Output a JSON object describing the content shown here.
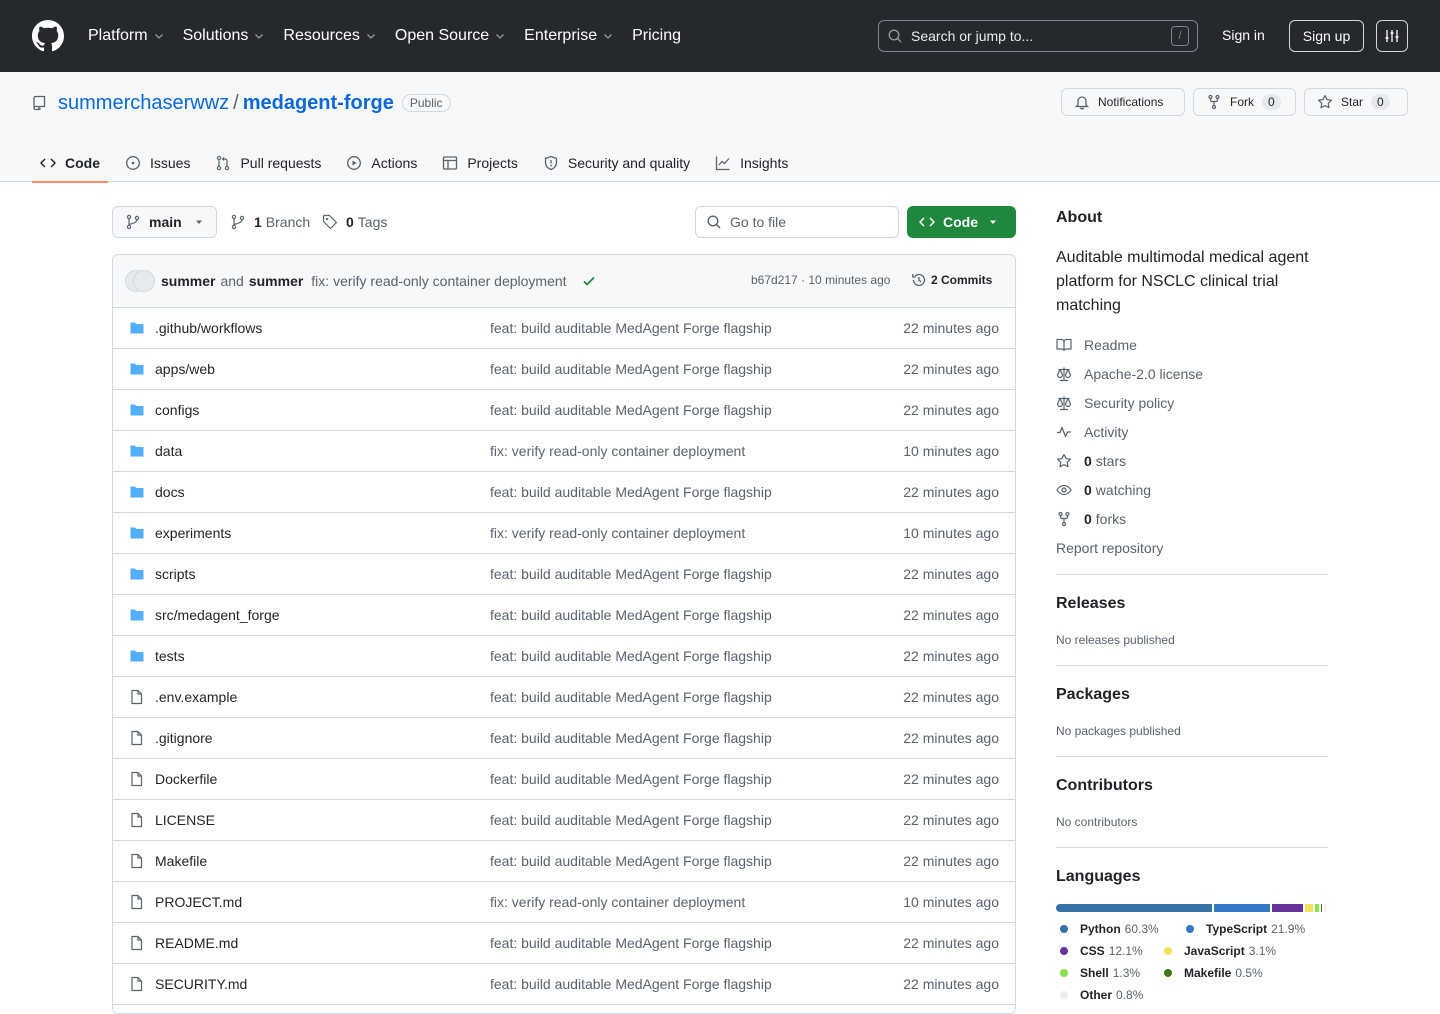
{
  "header": {
    "nav": [
      "Platform",
      "Solutions",
      "Resources",
      "Open Source",
      "Enterprise",
      "Pricing"
    ],
    "search_placeholder": "Search or jump to...",
    "search_key": "/",
    "sign_in": "Sign in",
    "sign_up": "Sign up"
  },
  "repo": {
    "owner": "summerchaserwwz",
    "separator": "/",
    "name": "medagent-forge",
    "visibility": "Public",
    "notifications": "Notifications",
    "fork_label": "Fork",
    "fork_count": "0",
    "star_label": "Star",
    "star_count": "0"
  },
  "tabs": [
    "Code",
    "Issues",
    "Pull requests",
    "Actions",
    "Projects",
    "Security and quality",
    "Insights"
  ],
  "browser": {
    "branch": "main",
    "branch_count": "1",
    "branch_label": "Branch",
    "tag_count": "0",
    "tag_label": "Tags",
    "goto_placeholder": "Go to file",
    "code_button": "Code"
  },
  "commit": {
    "author1": "summer",
    "and": "and",
    "author2": "summer",
    "message": "fix: verify read-only container deployment",
    "sha_time": "b67d217 · 10 minutes ago",
    "commits": "2 Commits"
  },
  "files": [
    {
      "type": "dir",
      "name": ".github/workflows",
      "message": "feat: build auditable MedAgent Forge flagship",
      "time": "22 minutes ago"
    },
    {
      "type": "dir",
      "name": "apps/web",
      "message": "feat: build auditable MedAgent Forge flagship",
      "time": "22 minutes ago"
    },
    {
      "type": "dir",
      "name": "configs",
      "message": "feat: build auditable MedAgent Forge flagship",
      "time": "22 minutes ago"
    },
    {
      "type": "dir",
      "name": "data",
      "message": "fix: verify read-only container deployment",
      "time": "10 minutes ago"
    },
    {
      "type": "dir",
      "name": "docs",
      "message": "feat: build auditable MedAgent Forge flagship",
      "time": "22 minutes ago"
    },
    {
      "type": "dir",
      "name": "experiments",
      "message": "fix: verify read-only container deployment",
      "time": "10 minutes ago"
    },
    {
      "type": "dir",
      "name": "scripts",
      "message": "feat: build auditable MedAgent Forge flagship",
      "time": "22 minutes ago"
    },
    {
      "type": "dir",
      "name": "src/medagent_forge",
      "message": "feat: build auditable MedAgent Forge flagship",
      "time": "22 minutes ago"
    },
    {
      "type": "dir",
      "name": "tests",
      "message": "feat: build auditable MedAgent Forge flagship",
      "time": "22 minutes ago"
    },
    {
      "type": "file",
      "name": ".env.example",
      "message": "feat: build auditable MedAgent Forge flagship",
      "time": "22 minutes ago"
    },
    {
      "type": "file",
      "name": ".gitignore",
      "message": "feat: build auditable MedAgent Forge flagship",
      "time": "22 minutes ago"
    },
    {
      "type": "file",
      "name": "Dockerfile",
      "message": "feat: build auditable MedAgent Forge flagship",
      "time": "22 minutes ago"
    },
    {
      "type": "file",
      "name": "LICENSE",
      "message": "feat: build auditable MedAgent Forge flagship",
      "time": "22 minutes ago"
    },
    {
      "type": "file",
      "name": "Makefile",
      "message": "feat: build auditable MedAgent Forge flagship",
      "time": "22 minutes ago"
    },
    {
      "type": "file",
      "name": "PROJECT.md",
      "message": "fix: verify read-only container deployment",
      "time": "10 minutes ago"
    },
    {
      "type": "file",
      "name": "README.md",
      "message": "feat: build auditable MedAgent Forge flagship",
      "time": "22 minutes ago"
    },
    {
      "type": "file",
      "name": "SECURITY.md",
      "message": "feat: build auditable MedAgent Forge flagship",
      "time": "22 minutes ago"
    }
  ],
  "about": {
    "title": "About",
    "description": "Auditable multimodal medical agent platform for NSCLC clinical trial matching",
    "links": [
      {
        "icon": "book-icon",
        "label": "Readme",
        "count": ""
      },
      {
        "icon": "scale-icon",
        "label": "Apache-2.0 license",
        "count": ""
      },
      {
        "icon": "scale-icon",
        "label": "Security policy",
        "count": ""
      },
      {
        "icon": "pulse-icon",
        "label": "Activity",
        "count": ""
      },
      {
        "icon": "star-icon",
        "label": "stars",
        "count": "0"
      },
      {
        "icon": "eye-icon",
        "label": "watching",
        "count": "0"
      },
      {
        "icon": "fork-icon",
        "label": "forks",
        "count": "0"
      }
    ],
    "report": "Report repository"
  },
  "releases": {
    "title": "Releases",
    "text": "No releases published"
  },
  "packages": {
    "title": "Packages",
    "text": "No packages published"
  },
  "contributors": {
    "title": "Contributors",
    "text": "No contributors"
  },
  "languages": {
    "title": "Languages",
    "items": [
      {
        "name": "Python",
        "percent": "60.3%",
        "value": 60.3,
        "color": "#3572A5"
      },
      {
        "name": "TypeScript",
        "percent": "21.9%",
        "value": 21.9,
        "color": "#3178c6"
      },
      {
        "name": "CSS",
        "percent": "12.1%",
        "value": 12.1,
        "color": "#663399"
      },
      {
        "name": "JavaScript",
        "percent": "3.1%",
        "value": 3.1,
        "color": "#f1e05a"
      },
      {
        "name": "Shell",
        "percent": "1.3%",
        "value": 1.3,
        "color": "#89e051"
      },
      {
        "name": "Makefile",
        "percent": "0.5%",
        "value": 0.5,
        "color": "#427819"
      },
      {
        "name": "Other",
        "percent": "0.8%",
        "value": 0.8,
        "color": "#ededed"
      }
    ]
  }
}
